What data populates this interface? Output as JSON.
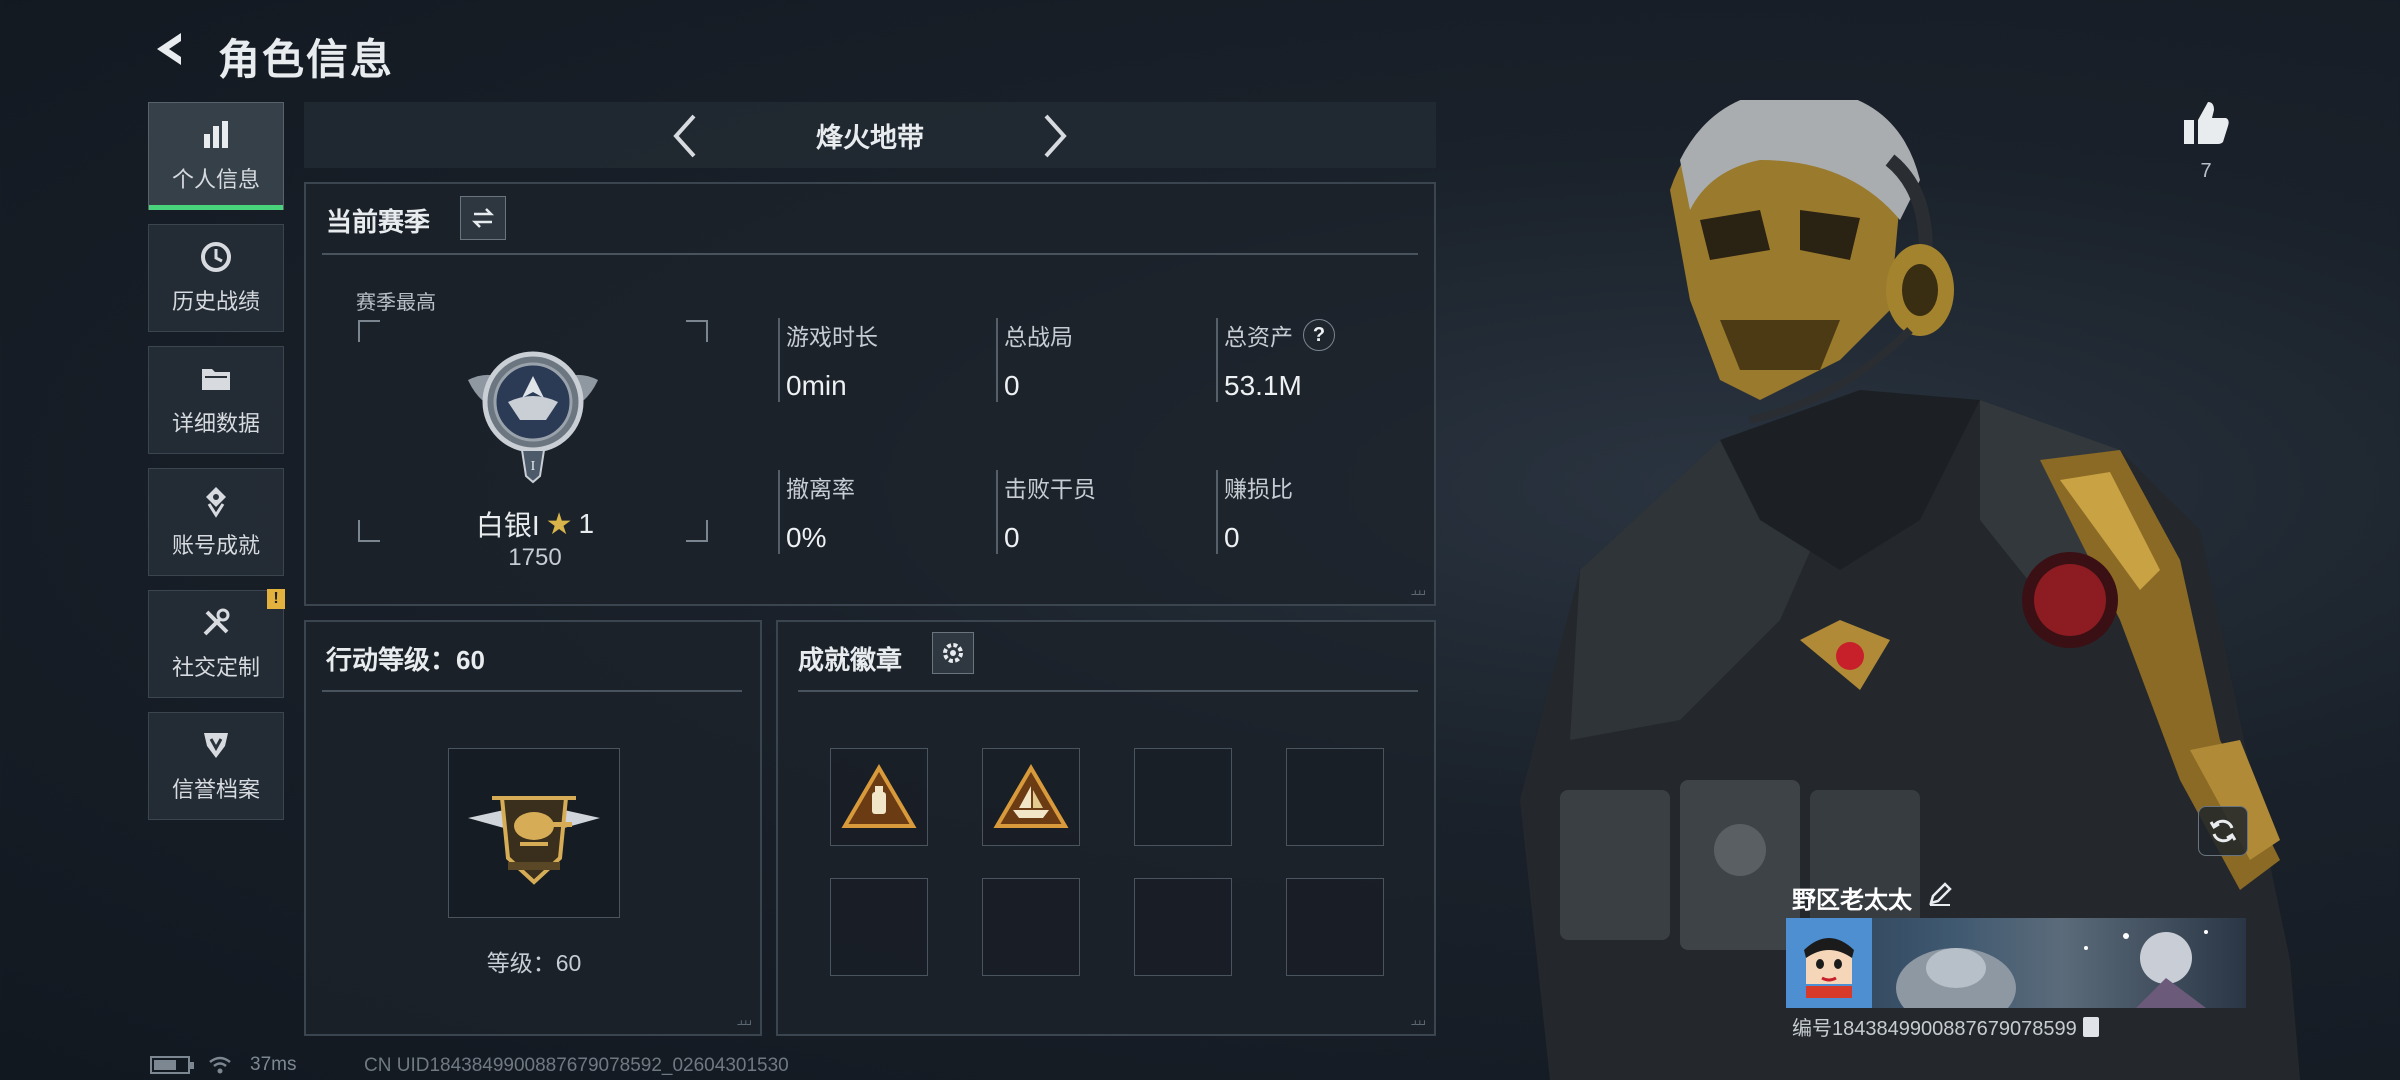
{
  "header": {
    "title": "角色信息"
  },
  "sidenav": {
    "items": [
      {
        "label": "个人信息",
        "icon": "bar-chart-icon",
        "active": true
      },
      {
        "label": "历史战绩",
        "icon": "history-clock-icon",
        "active": false
      },
      {
        "label": "详细数据",
        "icon": "folder-icon",
        "active": false
      },
      {
        "label": "账号成就",
        "icon": "achievement-icon",
        "active": false
      },
      {
        "label": "社交定制",
        "icon": "tools-icon",
        "active": false,
        "badge": "!"
      },
      {
        "label": "信誉档案",
        "icon": "shield-icon",
        "active": false
      }
    ]
  },
  "mode": {
    "label": "烽火地带"
  },
  "season": {
    "title": "当前赛季",
    "best_label": "赛季最高",
    "rank_name": "白银I",
    "rank_star": "★",
    "rank_stars": "1",
    "rank_score": "1750",
    "stats": [
      {
        "label": "游戏时长",
        "value": "0min"
      },
      {
        "label": "总战局",
        "value": "0"
      },
      {
        "label": "总资产",
        "value": "53.1M",
        "help": "?"
      },
      {
        "label": "撤离率",
        "value": "0%"
      },
      {
        "label": "击败干员",
        "value": "0"
      },
      {
        "label": "赚损比",
        "value": "0"
      }
    ]
  },
  "action_level": {
    "title": "行动等级：60",
    "caption": "等级：60"
  },
  "achievements": {
    "title": "成就徽章",
    "slots": [
      {
        "icon": "triangle-badge-bottle-icon",
        "filled": true
      },
      {
        "icon": "triangle-badge-boat-icon",
        "filled": true
      },
      {
        "filled": false
      },
      {
        "filled": false
      },
      {
        "filled": false
      },
      {
        "filled": false
      },
      {
        "filled": false
      },
      {
        "filled": false
      }
    ]
  },
  "statusbar": {
    "ping": "37ms",
    "uid_line": "CN UID1843849900887679078592_02604301530"
  },
  "profile": {
    "likes": "7",
    "player_name": "野区老太太",
    "player_id": "编号1843849900887679078599"
  },
  "colors": {
    "accent_green": "#49d37a",
    "gold": "#d8b44a",
    "badge_yellow": "#e3b13d"
  }
}
